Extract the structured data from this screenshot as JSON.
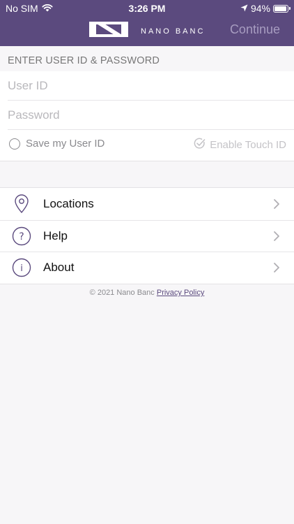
{
  "status_bar": {
    "carrier": "No SIM",
    "time": "3:26 PM",
    "battery": "94%",
    "battery_level": 0.94
  },
  "header": {
    "brand_name": "NANO BANC",
    "continue_label": "Continue"
  },
  "login": {
    "section_title": "ENTER USER ID & PASSWORD",
    "user_id_placeholder": "User ID",
    "user_id_value": "",
    "password_placeholder": "Password",
    "password_value": "",
    "save_user_id_label": "Save my User ID",
    "enable_touch_id_label": "Enable Touch ID"
  },
  "menu": {
    "items": [
      {
        "label": "Locations",
        "icon": "location-pin-icon"
      },
      {
        "label": "Help",
        "icon": "question-circle-icon"
      },
      {
        "label": "About",
        "icon": "info-circle-icon"
      }
    ]
  },
  "footer": {
    "copyright": "© 2021 Nano Banc",
    "privacy_link": "Privacy Policy"
  },
  "colors": {
    "brand_purple": "#5b4a7e",
    "continue_disabled": "#a79cc0",
    "background": "#f7f6f8"
  }
}
